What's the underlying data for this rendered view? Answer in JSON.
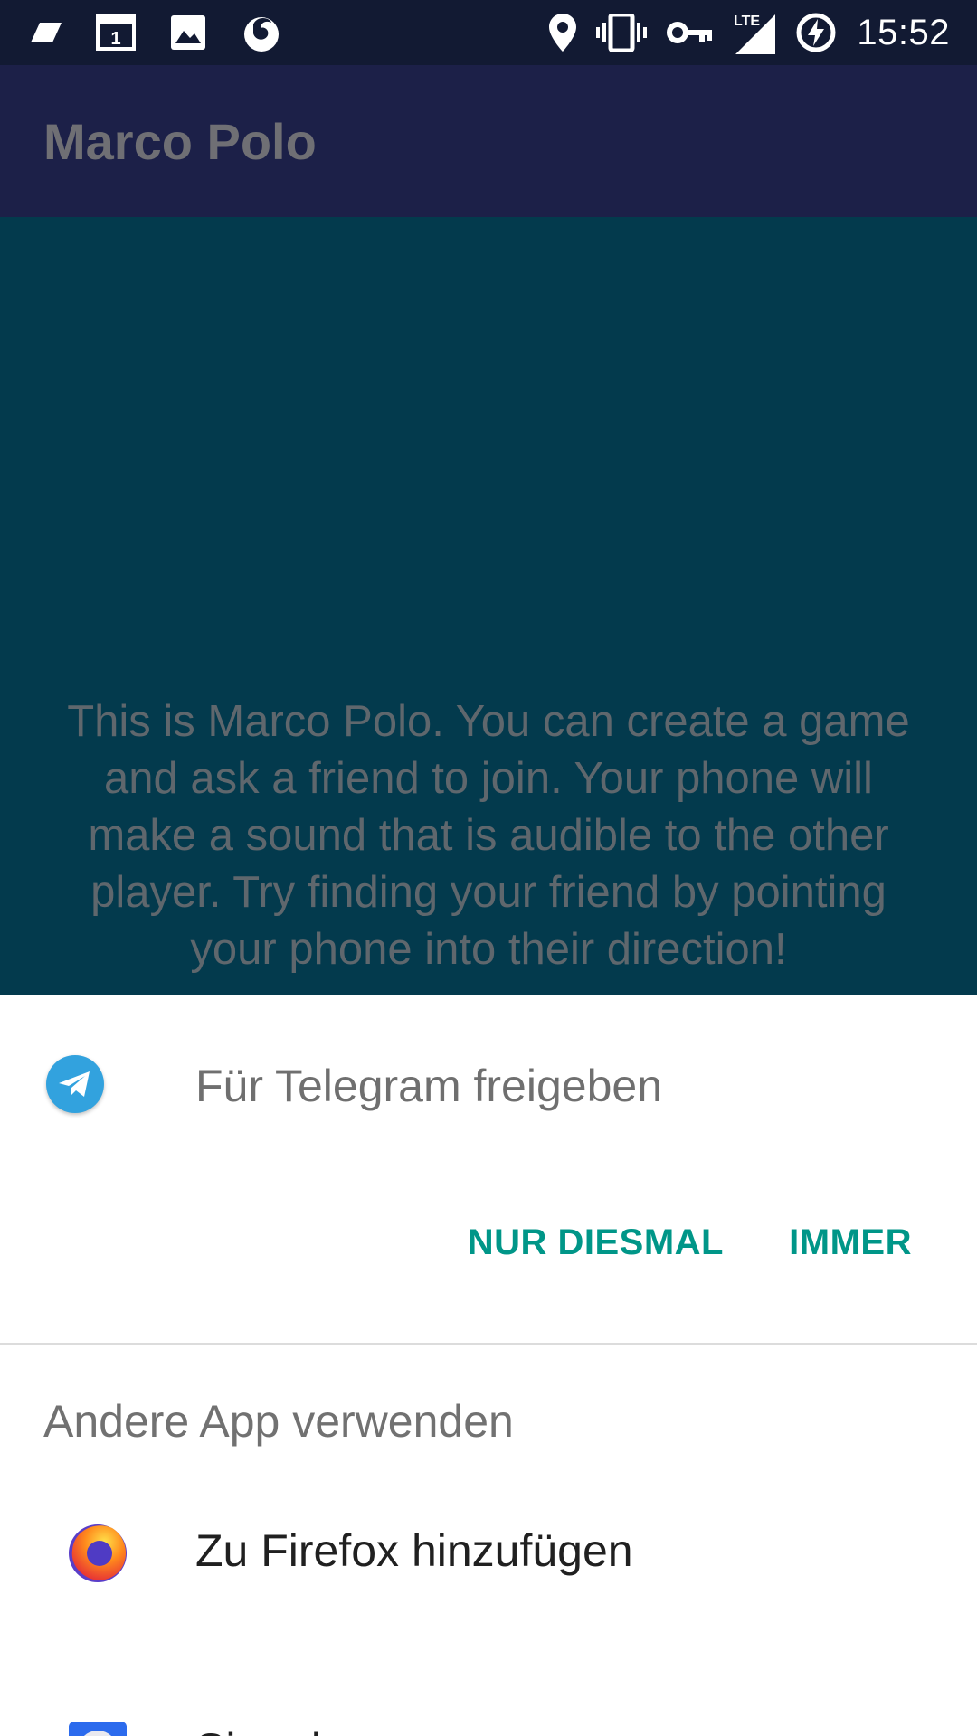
{
  "status_bar": {
    "time": "15:52",
    "network_label": "LTE",
    "left_icons": [
      "tag-icon",
      "calendar-icon",
      "image-icon",
      "firefox-notification-icon"
    ],
    "calendar_day": "1",
    "right_icons": [
      "location-icon",
      "vibrate-icon",
      "vpn-key-icon",
      "signal-icon",
      "battery-charging-icon"
    ]
  },
  "app_bar": {
    "title": "Marco Polo"
  },
  "content": {
    "intro": "This is Marco Polo. You can create a game and ask a friend to join. Your phone will make a sound that is audible to the other player. Try finding your friend by pointing your phone into their direction!"
  },
  "sheet": {
    "preferred_app_label": "Für Telegram freigeben",
    "preferred_app_icon": "telegram-icon",
    "just_once_label": "NUR DIESMAL",
    "always_label": "IMMER",
    "other_apps_header": "Andere App verwenden",
    "apps": [
      {
        "label": "Zu Firefox hinzufügen",
        "icon": "firefox-icon"
      },
      {
        "label": "Signal",
        "icon": "signal-app-icon"
      }
    ]
  },
  "colors": {
    "status_bar": "#121a33",
    "app_bar": "#1c2048",
    "content_bg": "#033a4d",
    "accent": "#009688",
    "telegram": "#32a2de",
    "signal": "#2c6bed"
  }
}
